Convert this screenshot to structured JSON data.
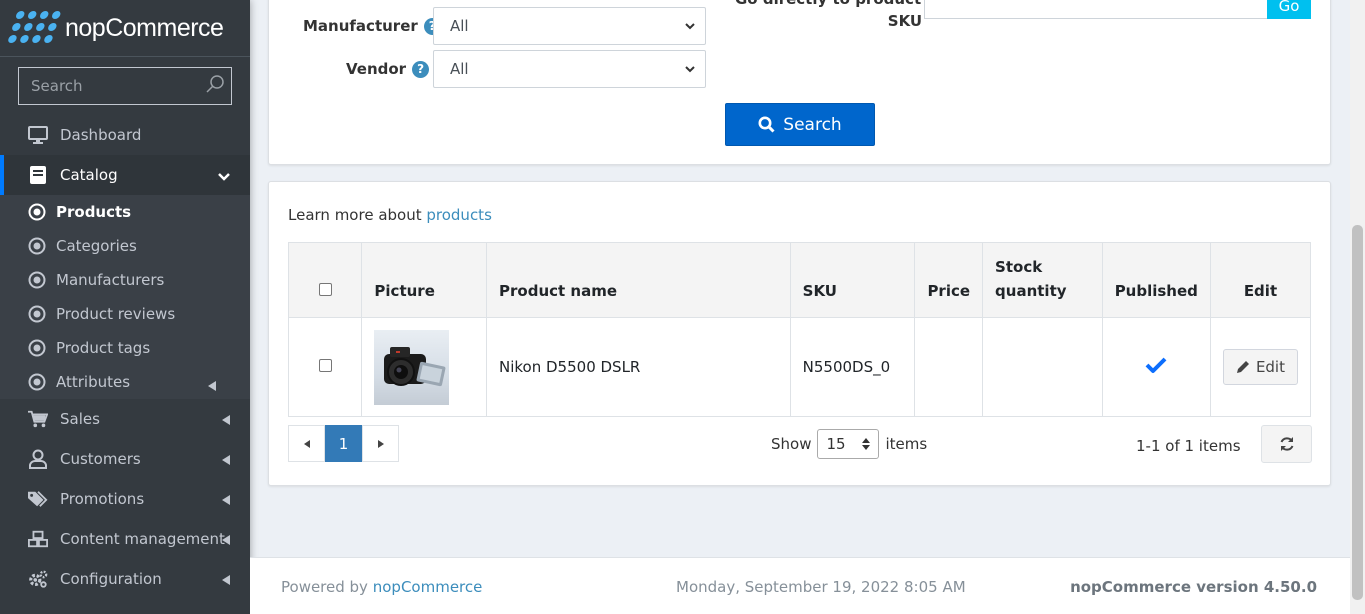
{
  "brand": {
    "name": "nopCommerce",
    "accent": "#4ab2f1"
  },
  "sidebar": {
    "search_placeholder": "Search",
    "items": [
      {
        "label": "Dashboard",
        "icon": "monitor-icon"
      },
      {
        "label": "Catalog",
        "icon": "book-icon"
      },
      {
        "label": "Sales",
        "icon": "cart-icon"
      },
      {
        "label": "Customers",
        "icon": "user-icon"
      },
      {
        "label": "Promotions",
        "icon": "tags-icon"
      },
      {
        "label": "Content management",
        "icon": "cubes-icon"
      },
      {
        "label": "Configuration",
        "icon": "gears-icon"
      }
    ],
    "catalog_sub": [
      "Products",
      "Categories",
      "Manufacturers",
      "Product reviews",
      "Product tags",
      "Attributes"
    ]
  },
  "search_panel": {
    "manufacturer_label": "Manufacturer",
    "manufacturer_value": "All",
    "vendor_label": "Vendor",
    "vendor_value": "All",
    "go_sku_label_line1": "Go directly to product",
    "go_sku_label_line2": "SKU",
    "go_button": "Go",
    "search_button": "Search"
  },
  "grid": {
    "learn_prefix": "Learn more about",
    "learn_link": "products",
    "columns": [
      "Picture",
      "Product name",
      "SKU",
      "Price",
      "Stock",
      "quantity",
      "Published",
      "Edit"
    ],
    "rows": [
      {
        "product_name": "Nikon D5500 DSLR",
        "sku": "N5500DS_0",
        "price": "",
        "stock": "",
        "published": true,
        "edit_label": "Edit"
      }
    ],
    "pager": {
      "current_page": "1",
      "show_label": "Show",
      "page_size": "15",
      "items_label": "items",
      "info": "1-1 of 1 items"
    }
  },
  "footer": {
    "powered_prefix": "Powered by",
    "powered_link": "nopCommerce",
    "datetime": "Monday, September 19, 2022 8:05 AM",
    "version": "nopCommerce version 4.50.0"
  }
}
